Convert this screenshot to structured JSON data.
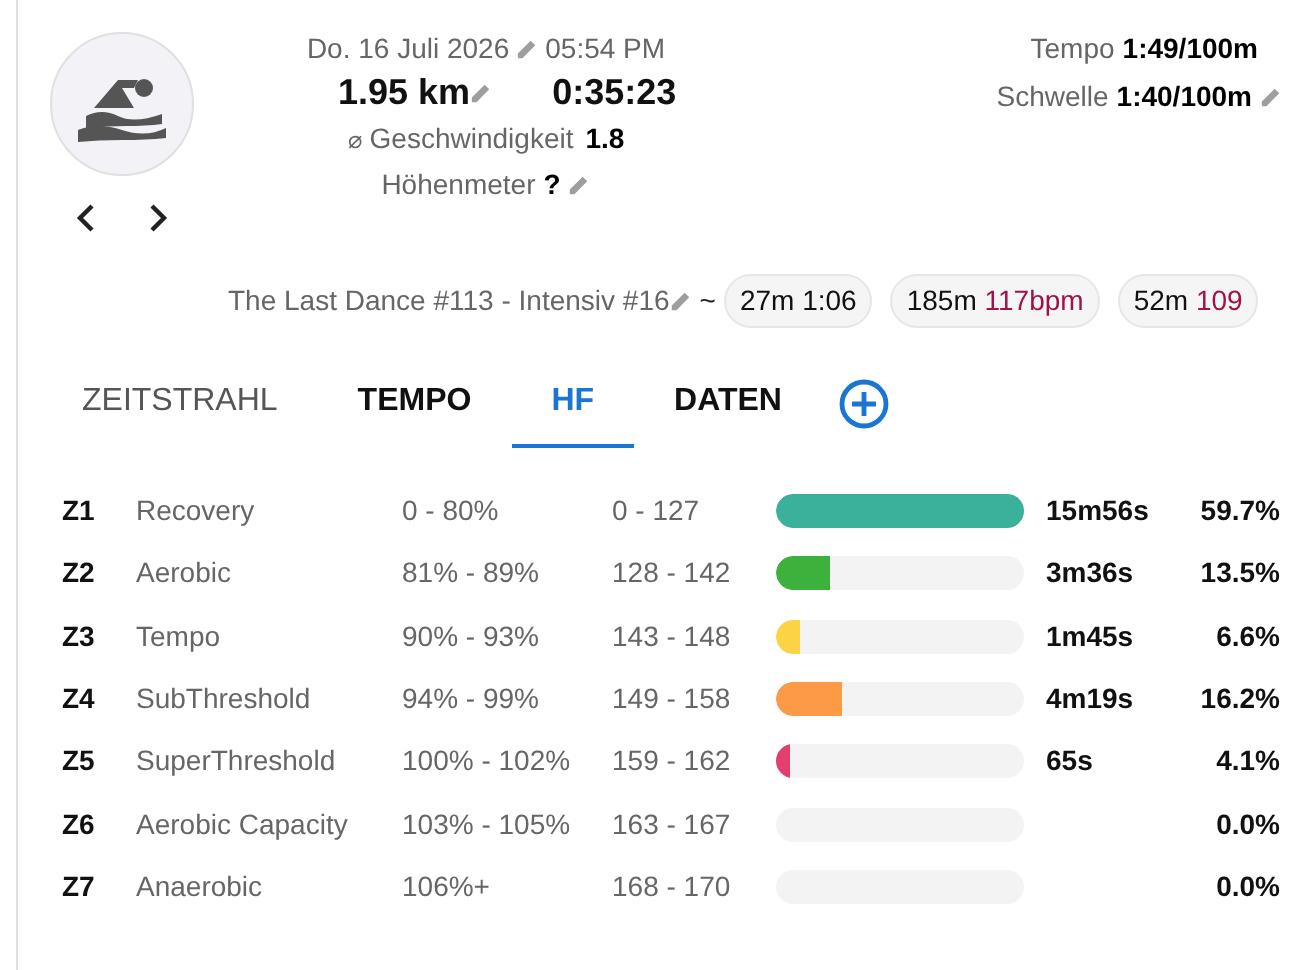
{
  "header": {
    "date": "Do. 16 Juli 2026",
    "time": "05:54 PM",
    "distance": "1.95 km",
    "duration": "0:35:23",
    "speed_symbol": "⌀",
    "speed_label": "Geschwindigkeit",
    "speed": "1.8",
    "elevation_label": "Höhenmeter",
    "elevation": "?",
    "pace_label": "Tempo",
    "pace": "1:49/100m",
    "threshold_label": "Schwelle",
    "threshold": "1:40/100m"
  },
  "workout": {
    "title": "The Last Dance #113 - Intensiv #16",
    "separator": "~",
    "chips": [
      {
        "distance": "27m",
        "value": "1:06",
        "accent": false
      },
      {
        "distance": "185m",
        "value": "117bpm",
        "accent": true
      },
      {
        "distance": "52m",
        "value": "109",
        "accent": true
      }
    ]
  },
  "tabs": [
    {
      "label": "ZEITSTRAHL",
      "selected": false
    },
    {
      "label": "TEMPO",
      "selected": false
    },
    {
      "label": "HF",
      "selected": true
    },
    {
      "label": "DATEN",
      "selected": false
    }
  ],
  "zones": [
    {
      "zone": "Z1",
      "name": "Recovery",
      "percent": "0 - 80%",
      "bpm": "0 - 127",
      "color": "#3bb19b",
      "level": 1.0,
      "time": "15m56s",
      "share": "59.7%"
    },
    {
      "zone": "Z2",
      "name": "Aerobic",
      "percent": "81% - 89%",
      "bpm": "128 - 142",
      "color": "#3cb13c",
      "level": 0.22,
      "time": "3m36s",
      "share": "13.5%"
    },
    {
      "zone": "Z3",
      "name": "Tempo",
      "percent": "90% - 93%",
      "bpm": "143 - 148",
      "color": "#fbd345",
      "level": 0.1,
      "time": "1m45s",
      "share": "6.6%"
    },
    {
      "zone": "Z4",
      "name": "SubThreshold",
      "percent": "94% - 99%",
      "bpm": "149 - 158",
      "color": "#fc9a45",
      "level": 0.27,
      "time": "4m19s",
      "share": "16.2%"
    },
    {
      "zone": "Z5",
      "name": "SuperThreshold",
      "percent": "100% - 102%",
      "bpm": "159 - 162",
      "color": "#e23e6e",
      "level": 0.06,
      "time": "65s",
      "share": "4.1%"
    },
    {
      "zone": "Z6",
      "name": "Aerobic Capacity",
      "percent": "103% - 105%",
      "bpm": "163 - 167",
      "share": "0.0%"
    },
    {
      "zone": "Z7",
      "name": "Anaerobic",
      "percent": "106%+",
      "bpm": "168 - 170",
      "share": "0.0%"
    }
  ]
}
